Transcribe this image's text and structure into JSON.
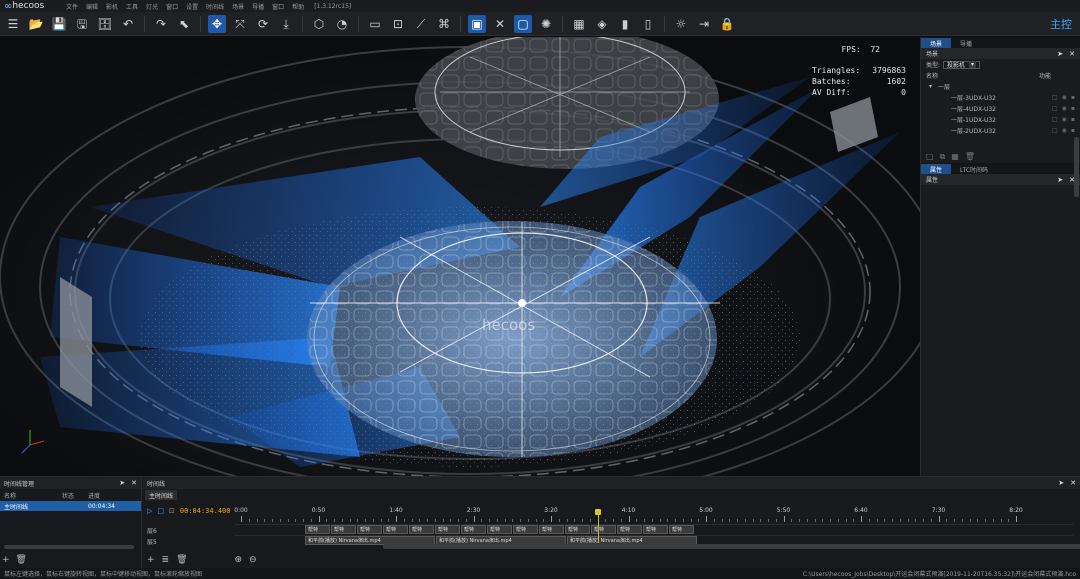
{
  "app": {
    "logo_text": "hecoos",
    "version": "[1.3.12rc15]",
    "menu": [
      "文件",
      "编辑",
      "影机",
      "工具",
      "灯光",
      "窗口",
      "设置",
      "时间线",
      "场景",
      "导播",
      "窗口",
      "帮助"
    ],
    "mode_label": "主控"
  },
  "toolbar": {
    "icons": [
      "menu-icon",
      "open-folder-icon",
      "save-icon",
      "save-as-icon",
      "archive-icon",
      "undo-icon",
      "redo-icon",
      "select-icon",
      "move-icon",
      "transform-icon",
      "rotate-icon",
      "import-icon",
      "cube-icon",
      "projector-icon",
      "vr-icon",
      "focus-icon",
      "ruler-icon",
      "tag-icon",
      "frame-icon",
      "cross-icon",
      "screen-icon",
      "light-icon",
      "grid-icon",
      "paint-icon",
      "video-icon",
      "media-icon",
      "sun-icon",
      "export-icon",
      "lock-icon"
    ],
    "active": [
      8,
      18,
      20
    ]
  },
  "viewport": {
    "fps_label": "FPS:",
    "fps_value": "72",
    "stats": [
      {
        "label": "Triangles:",
        "value": "3796863"
      },
      {
        "label": "Batches:",
        "value": "1602"
      },
      {
        "label": "AV Diff:",
        "value": "0"
      }
    ],
    "watermark": "hecoos"
  },
  "scene_panel": {
    "tabs": [
      "场景",
      "导播"
    ],
    "title": "场景",
    "type_label": "类型:",
    "type_value": "投影机",
    "col_name": "名称",
    "col_func": "功能",
    "root": "一层",
    "items": [
      "一层-3UDX-U32",
      "一层-4UDX-U32",
      "一层-1UDX-U32",
      "一层-2UDX-U32"
    ]
  },
  "props_panel": {
    "tabs": [
      "属性",
      "LTC时间码"
    ],
    "title": "属性"
  },
  "timeline_manager": {
    "title": "时间线管理",
    "cols": [
      "名称",
      "状态",
      "进度"
    ],
    "row": {
      "name": "主时间线",
      "status": "",
      "progress": "00:04:34"
    }
  },
  "timeline": {
    "title": "时间线",
    "tab": "主时间线",
    "current_time": "00:04:34.400",
    "ticks": [
      "0:00",
      "0:50",
      "1:40",
      "2:30",
      "3:20",
      "4:10",
      "5:00",
      "5:50",
      "6:40",
      "7:30",
      "8:20"
    ],
    "tracks": [
      {
        "name": "层6",
        "clips": [
          "帮特",
          "帮特",
          "帮特",
          "帮特",
          "帮特",
          "帮特",
          "帮特",
          "帮特",
          "帮特",
          "帮特",
          "帮特",
          "帮特",
          "帮特",
          "帮特",
          "帮特"
        ]
      },
      {
        "name": "层5",
        "clips": [
          "和平鸽(播放) Nirvana演出.mp4",
          "和平鸽(播放) Nirvana演出.mp4",
          "和平鸽(播放) Nirvana演出.mp4"
        ]
      }
    ],
    "playhead_fraction": 0.46
  },
  "status": {
    "left": "鼠标左键选择，鼠标右键旋转视图，鼠标中键移动视图，鼠标滚轮缩放视图",
    "right": "C:\\Users\\hecoos_Jobs\\Desktop\\开运会闭幕式预演[2019-11-20T16.35.32]\\开运会闭幕式预演.hco"
  },
  "colors": {
    "accent": "#1f5aa8",
    "beam": "#1d7dff",
    "playhead": "#d4cc20",
    "time": "#f0a020"
  }
}
